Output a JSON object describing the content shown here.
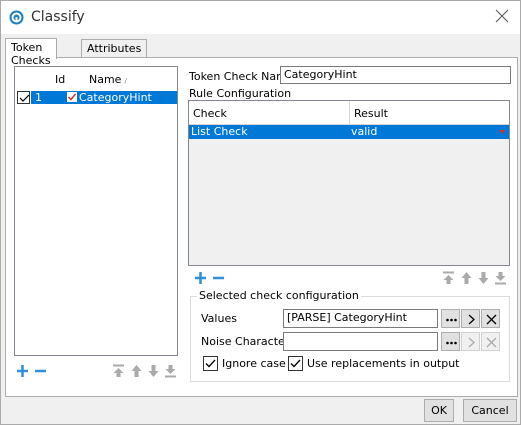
{
  "window": {
    "title": "Classify"
  },
  "tabs": [
    {
      "label": "Token Checks",
      "active": true
    },
    {
      "label": "Attributes",
      "active": false
    }
  ],
  "token_list": {
    "columns": [
      "Id",
      "Name"
    ],
    "rows": [
      {
        "id": "1",
        "name": "CategoryHint",
        "checked": true,
        "selected": true
      }
    ]
  },
  "token_check_name": {
    "label": "Token Check Name",
    "value": "CategoryHint"
  },
  "rule_configuration": {
    "label": "Rule Configuration",
    "columns": [
      "Check",
      "Result"
    ],
    "rows": [
      {
        "check": "List Check",
        "result": "valid",
        "selected": true
      }
    ]
  },
  "selected_check": {
    "title": "Selected check configuration",
    "values": {
      "label": "Values",
      "value": "[PARSE] CategoryHint"
    },
    "noise": {
      "label": "Noise Characters",
      "value": ""
    },
    "ignore_case": {
      "label": "Ignore case",
      "checked": true
    },
    "use_replacements": {
      "label": "Use replacements in output",
      "checked": true
    }
  },
  "buttons": {
    "ok": "OK",
    "cancel": "Cancel"
  },
  "colors": {
    "selection": "#0078d7",
    "add": "#2f8fd8",
    "valid": "#d93025"
  }
}
